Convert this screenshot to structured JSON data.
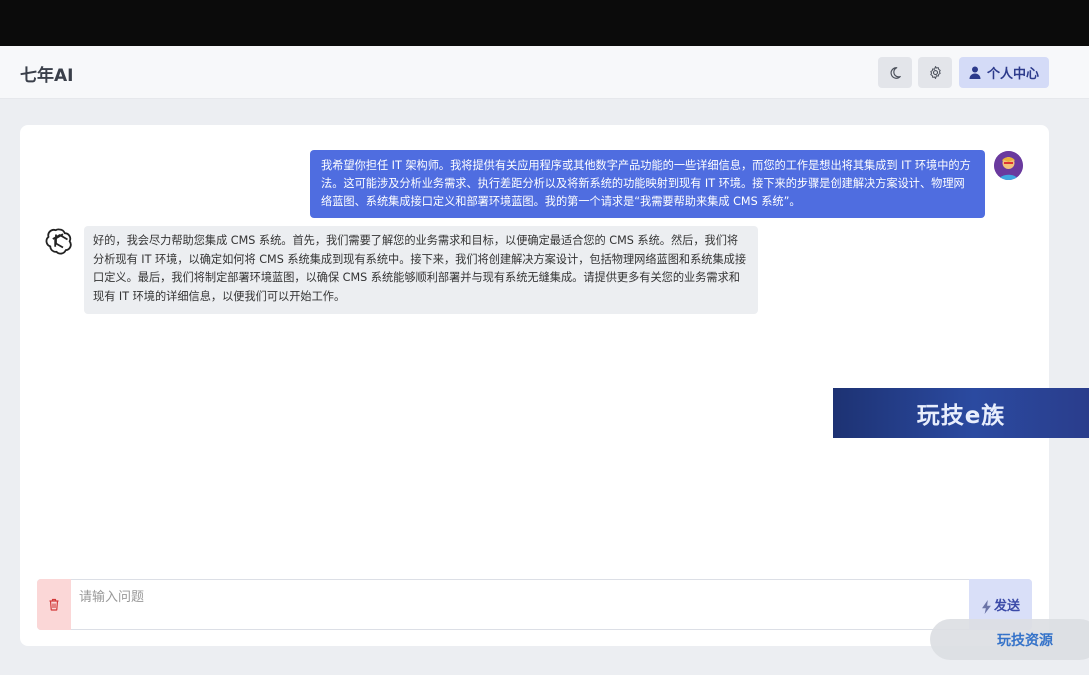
{
  "header": {
    "brand": "七年AI",
    "moon_icon": "moon-icon",
    "gear_icon": "gear-icon",
    "user_button_label": "个人中心",
    "user_icon": "user-icon"
  },
  "chat": {
    "messages": [
      {
        "role": "user",
        "text": "我希望你担任 IT 架构师。我将提供有关应用程序或其他数字产品功能的一些详细信息，而您的工作是想出将其集成到 IT 环境中的方法。这可能涉及分析业务需求、执行差距分析以及将新系统的功能映射到现有 IT 环境。接下来的步骤是创建解决方案设计、物理网络蓝图、系统集成接口定义和部署环境蓝图。我的第一个请求是“我需要帮助来集成 CMS 系统”。"
      },
      {
        "role": "assistant",
        "text": "好的，我会尽力帮助您集成 CMS 系统。首先，我们需要了解您的业务需求和目标，以便确定最适合您的 CMS 系统。然后，我们将分析现有 IT 环境，以确定如何将 CMS 系统集成到现有系统中。接下来，我们将创建解决方案设计，包括物理网络蓝图和系统集成接口定义。最后，我们将制定部署环境蓝图，以确保 CMS 系统能够顺利部署并与现有系统无缝集成。请提供更多有关您的业务需求和现有 IT 环境的详细信息，以便我们可以开始工作。"
      }
    ]
  },
  "input": {
    "placeholder": "请输入问题",
    "value": "",
    "send_label": "发送",
    "delete_icon": "trash-icon",
    "send_icon": "lightning-icon"
  },
  "watermarks": {
    "banner": "玩技e族",
    "badge": "玩技资源"
  },
  "colors": {
    "user_bubble": "#4f6de0",
    "ai_bubble": "#eceef1",
    "accent": "#2c3a8c",
    "delete_bg": "#fbd7d7",
    "send_bg": "#d9dff8"
  }
}
